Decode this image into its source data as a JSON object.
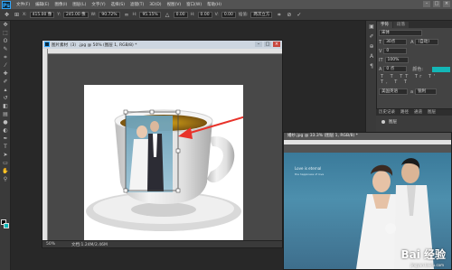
{
  "app": {
    "logo": "Ps"
  },
  "menu": [
    "文件(F)",
    "编辑(E)",
    "图像(I)",
    "图层(L)",
    "文字(Y)",
    "选择(S)",
    "滤镜(T)",
    "3D(D)",
    "视图(V)",
    "窗口(W)",
    "帮助(H)"
  ],
  "options": {
    "x_value": "415.00 像",
    "y_value": "245.00 像",
    "w_value": "90.72%",
    "h_value": "95.15%",
    "rotate_value": "0.00",
    "hskew_value": "0.00",
    "vskew_value": "0.00",
    "interp_value": "两次立方"
  },
  "doc1": {
    "title": "图片素材（3）.jpg @ 50% (图层 1, RGB/8) *",
    "zoom": "50%",
    "doc_size": "文档:1.24M/2.46M"
  },
  "panel": {
    "tabs": [
      "字符",
      "段落"
    ],
    "font": "宋体",
    "size": "30点",
    "leading": "(自动)",
    "tracking": "0",
    "scale": "100%",
    "baseline": "0 点",
    "color_label": "颜色:",
    "glyphs": "T T TT Tr T' T, T T",
    "language": "美国英语",
    "aa": "锐利"
  },
  "layers": {
    "tabs": [
      "历史记录",
      "路径",
      "通道",
      "图层"
    ],
    "row": "图层"
  },
  "doc2": {
    "title": "婚纱.jpg @ 33.3% (图层 1, RGB/8) *",
    "watermark": "Bai 经验",
    "watermark_url": "jingyan.baidu.com",
    "photo_line1": "Love is eternal",
    "photo_line2": "the happiness of love"
  },
  "colors": {
    "accent": "#31a8ff",
    "swatch_bg": "#00b7b7",
    "arrow": "#e8322a"
  }
}
